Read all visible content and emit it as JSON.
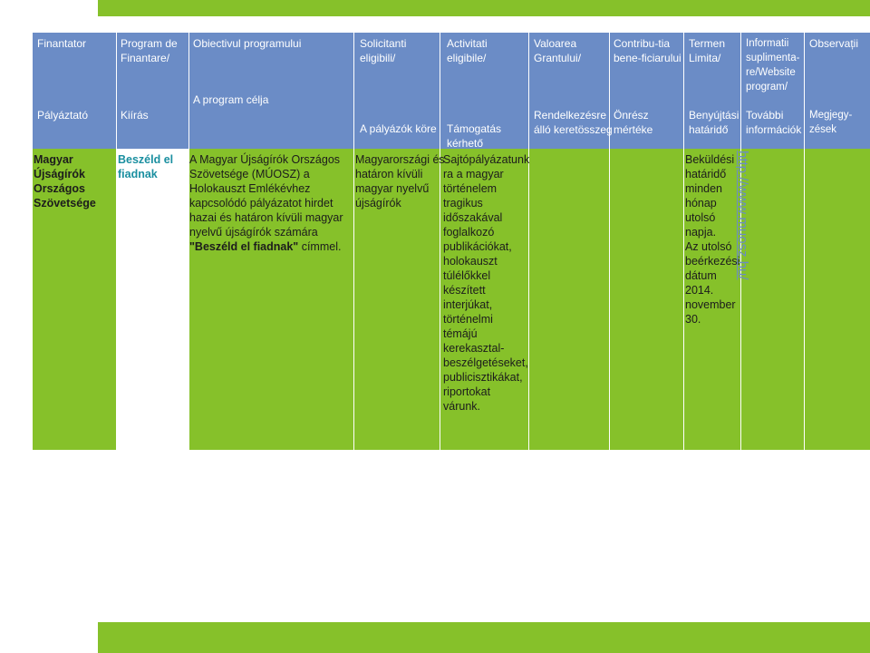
{
  "header_ro": {
    "finantator": "Finantator",
    "program": "Program de\nFinantare/",
    "obiectiv": "Obiectivul programului",
    "solicitanti": "Solicitanti\neligibili/",
    "activitati": "Activitati\neligibile/",
    "valoarea": "Valoarea\nGrantului/",
    "contributia": "Contribu-tia\nbene-ficiarului",
    "termen": "Termen\nLimita/",
    "informatii": "Informatii\nsuplimenta-\nre/Website\nprogram/",
    "observatii": "Observații"
  },
  "header_hu": {
    "palyaztato": "Pályáztató",
    "kiiras": "Kiírás",
    "program_celja": "A program célja",
    "palyazok_kore": "A pályázók köre",
    "tamogatas": "Támogatás\nkérhető",
    "rendelkezesre": "Rendelkezésre\nálló keretösszeg",
    "onresz": "Önrész\nmértéke",
    "benyujtasi": "Benyújtási\nhatáridő",
    "tovabbi": "További\ninformációk",
    "megjegyzesek": "Megjegy-\nzések"
  },
  "row": {
    "palyaztato": "Magyar\nÚjságírók\nOrszágos\nSzövetsége",
    "kiiras": "Beszéld el\nfiadnak",
    "program_celja_1": "A Magyar Újságírók Országos\nSzövetsége (MÚOSZ) a\nHolokauszt Emlékévhez\nkapcsolódó pályázatot hirdet\nhazai és határon kívüli magyar\nnyelvű újságírók számára\n",
    "program_celja_title": "\"Beszéld el fiadnak\"",
    "program_celja_2": " címmel.",
    "palyazok_kore": "Magyarországi és\nhatáron kívüli\nmagyar nyelvű\nújságírók",
    "tamogatas": "Sajtópályázatunk\nra a magyar\ntörténelem\ntragikus\nidőszakával\nfoglalkozó\npublikációkat,\nholokauszt\ntúlélőkkel\nkészített\ninterjúkat,\ntörténelmi\ntémájú\nkerekasztal-\nbeszélgetéseket,\npublicisztikákat,\nriportokat\nvárunk.",
    "hatarido": "Beküldési\nhatáridő\nminden\nhónap\nutolsó\nnapja.\nAz utolsó\nbeérkezési\ndátum\n2014.\nnovember\n30.",
    "website": "http://www.muosz.hu/"
  },
  "colors": {
    "header_blue": "#6b8cc6",
    "body_green": "#86c12a",
    "teal": "#1a8fa0"
  }
}
